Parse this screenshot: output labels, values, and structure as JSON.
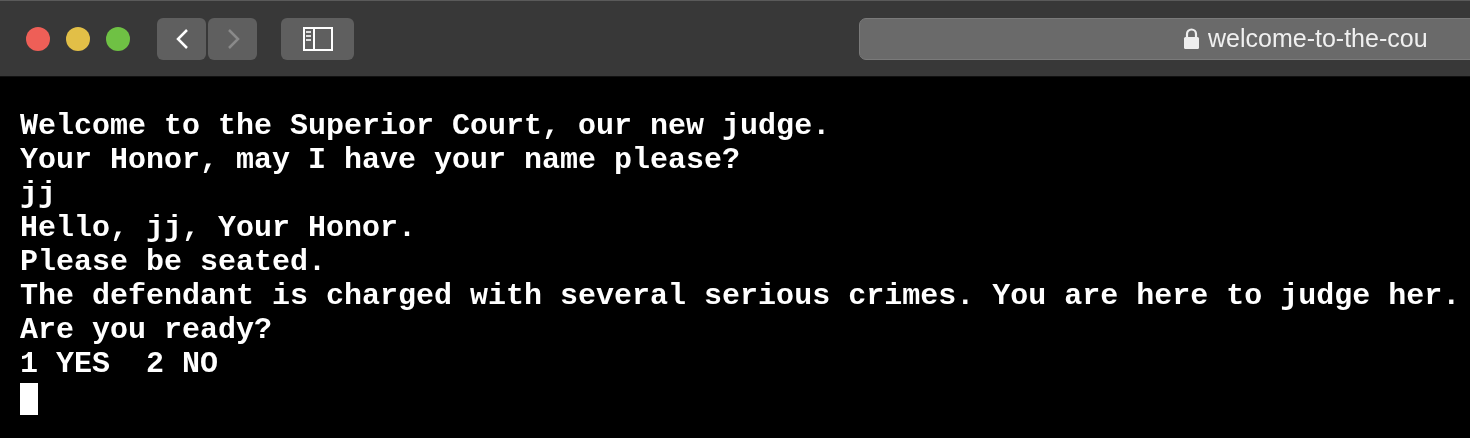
{
  "toolbar": {
    "nav_buttons": [
      {
        "kind": "back",
        "enabled": true
      },
      {
        "kind": "forward",
        "enabled": false
      }
    ],
    "address": {
      "secure": true,
      "url": "welcome-to-the-cou"
    }
  },
  "terminal": {
    "lines": [
      "Welcome to the Superior Court, our new judge.",
      "Your Honor, may I have your name please?",
      "jj",
      "Hello, jj, Your Honor.",
      "Please be seated.",
      "The defendant is charged with several serious crimes. You are here to judge her.",
      "Are you ready?",
      "1 YES  2 NO"
    ],
    "cursor": true
  }
}
